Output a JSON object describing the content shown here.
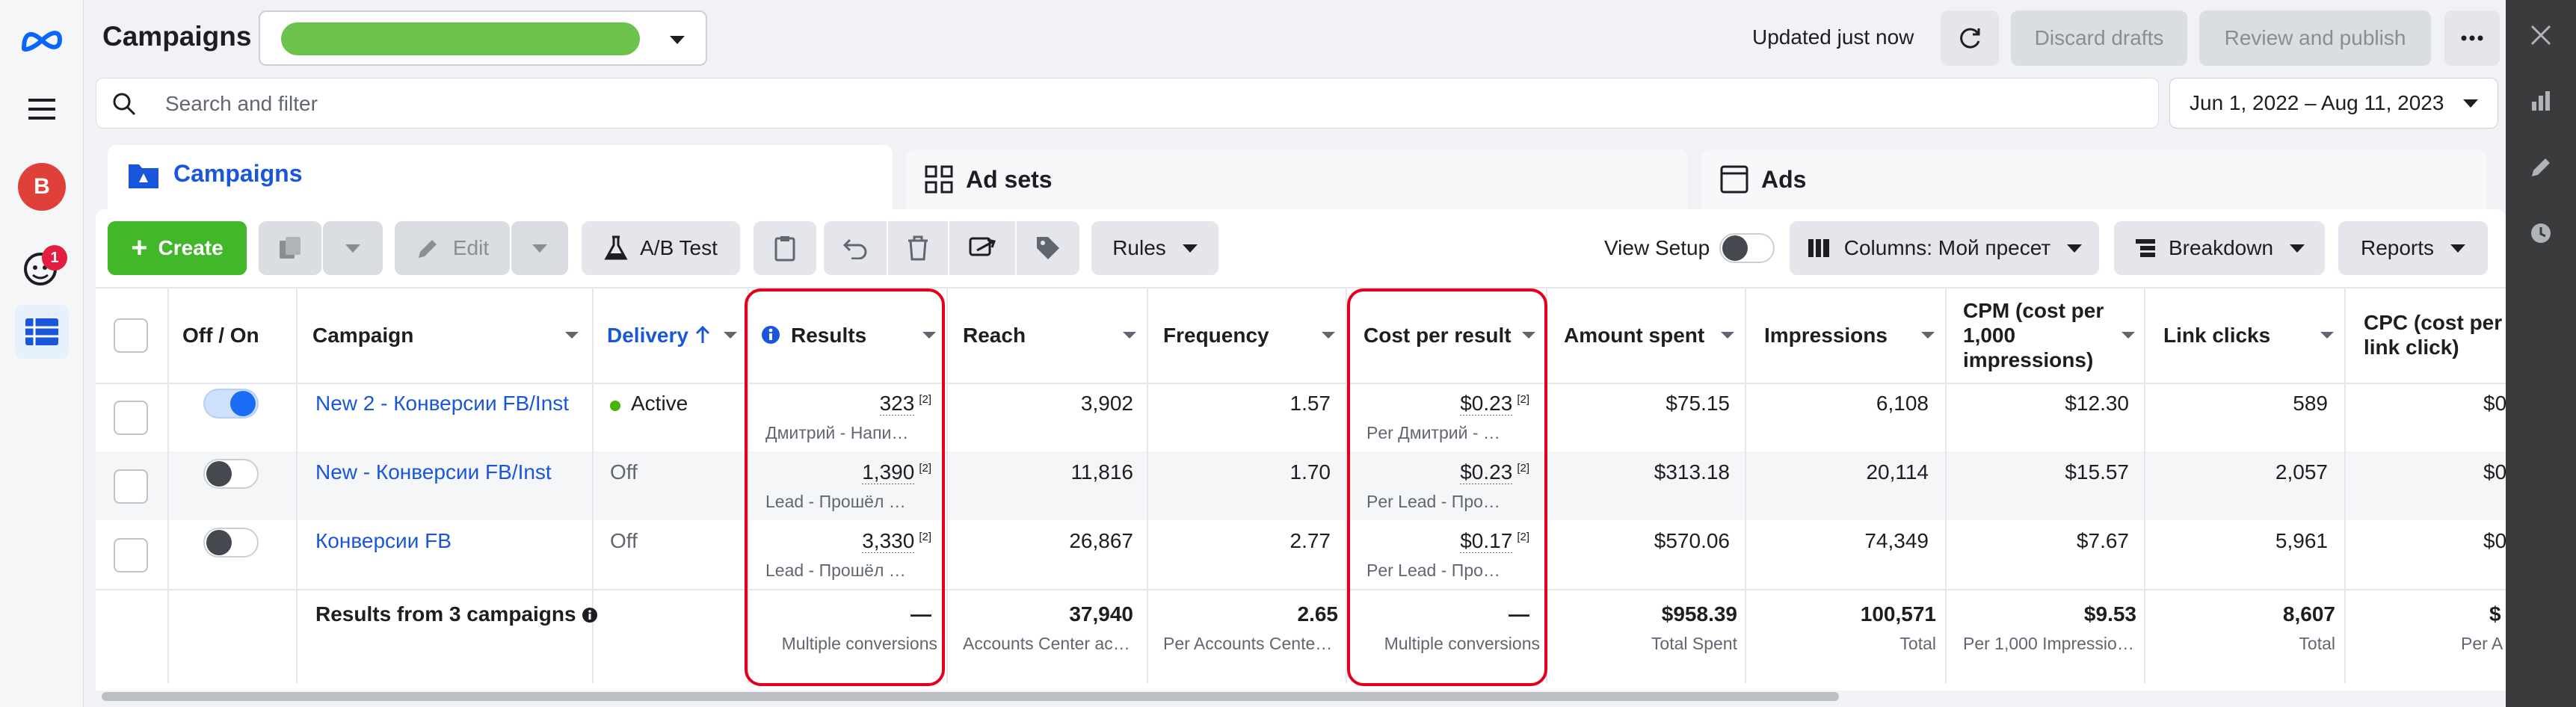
{
  "nav": {
    "avatar_letter": "B",
    "notification_count": "1"
  },
  "header": {
    "title": "Campaigns",
    "updated_text": "Updated just now",
    "discard_label": "Discard drafts",
    "review_label": "Review and publish"
  },
  "search": {
    "placeholder": "Search and filter",
    "date_range": "Jun 1, 2022 – Aug 11, 2023"
  },
  "tabs": {
    "campaigns": "Campaigns",
    "adsets": "Ad sets",
    "ads": "Ads"
  },
  "toolbar": {
    "create": "Create",
    "edit": "Edit",
    "abtest": "A/B Test",
    "rules": "Rules",
    "view_setup": "View Setup",
    "columns": "Columns: Мой пресет",
    "breakdown": "Breakdown",
    "reports": "Reports"
  },
  "columns": {
    "onoff": "Off / On",
    "campaign": "Campaign",
    "delivery": "Delivery",
    "results": "Results",
    "reach": "Reach",
    "frequency": "Frequency",
    "cpr": "Cost per result",
    "amount": "Amount spent",
    "impressions": "Impressions",
    "cpm": "CPM (cost per 1,000 impressions)",
    "clicks": "Link clicks",
    "cpc": "CPC (cost per link click)"
  },
  "rows": [
    {
      "name": "New 2 - Конверсии FB/Inst",
      "delivery": "Active",
      "on": true,
      "results": "323",
      "results_sub": "Дмитрий - Напи…",
      "reach": "3,902",
      "frequency": "1.57",
      "cpr": "$0.23",
      "cpr_sub": "Per Дмитрий - …",
      "amount": "$75.15",
      "impressions": "6,108",
      "cpm": "$12.30",
      "clicks": "589",
      "cpc": "$0"
    },
    {
      "name": "New - Конверсии FB/Inst",
      "delivery": "Off",
      "on": false,
      "results": "1,390",
      "results_sub": "Lead - Прошёл …",
      "reach": "11,816",
      "frequency": "1.70",
      "cpr": "$0.23",
      "cpr_sub": "Per Lead - Про…",
      "amount": "$313.18",
      "impressions": "20,114",
      "cpm": "$15.57",
      "clicks": "2,057",
      "cpc": "$0"
    },
    {
      "name": "Конверсии FB",
      "delivery": "Off",
      "on": false,
      "results": "3,330",
      "results_sub": "Lead - Прошёл …",
      "reach": "26,867",
      "frequency": "2.77",
      "cpr": "$0.17",
      "cpr_sub": "Per Lead - Про…",
      "amount": "$570.06",
      "impressions": "74,349",
      "cpm": "$7.67",
      "clicks": "5,961",
      "cpc": "$0"
    }
  ],
  "footnote": "[2]",
  "totals": {
    "label": "Results from 3 campaigns",
    "results": "—",
    "results_sub": "Multiple conversions",
    "reach": "37,940",
    "reach_sub": "Accounts Center ac…",
    "frequency": "2.65",
    "frequency_sub": "Per Accounts Cente…",
    "cpr": "—",
    "cpr_sub": "Multiple conversions",
    "amount": "$958.39",
    "amount_sub": "Total Spent",
    "impressions": "100,571",
    "impressions_sub": "Total",
    "cpm": "$9.53",
    "cpm_sub": "Per 1,000 Impressio…",
    "clicks": "8,607",
    "clicks_sub": "Total",
    "cpc": "$",
    "cpc_sub": "Per A"
  },
  "colors": {
    "accent": "#1a56db",
    "create_green": "#42b72a",
    "highlight_red": "#e4001b",
    "active_dot": "#44b700"
  }
}
